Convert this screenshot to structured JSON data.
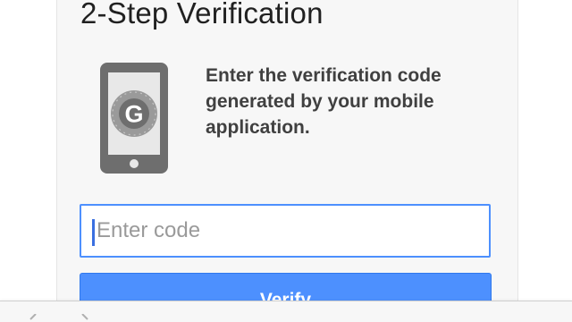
{
  "header": {
    "title": "2-Step Verification"
  },
  "instructions": {
    "text": "Enter the verification code generated by your mobile application."
  },
  "code_input": {
    "placeholder": "Enter code",
    "value": ""
  },
  "verify_button": {
    "label": "Verify"
  },
  "browser_toolbar": {
    "back_icon": "chevron-left-icon",
    "forward_icon": "chevron-right-icon"
  },
  "colors": {
    "accent": "#4d90fe",
    "card_background": "#f7f7f7",
    "phone_icon": "#6e6e6e"
  }
}
